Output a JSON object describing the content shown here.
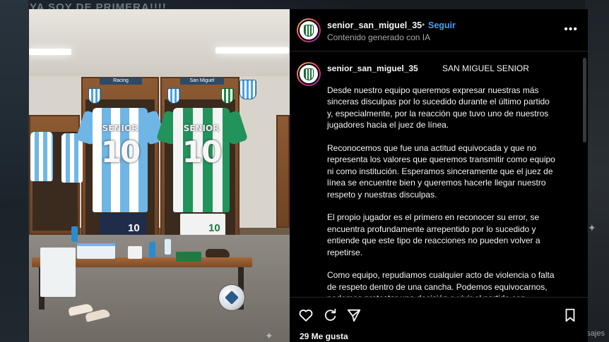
{
  "background": {
    "banner_text": "YA SOY DE PRIMERA!!!!",
    "corner_label": "sajes"
  },
  "image": {
    "left_nameplate": "Racing",
    "right_nameplate": "San Miguel",
    "left_jersey": {
      "name": "SENIOR",
      "number": "10",
      "color": "#6fb6e6"
    },
    "right_jersey": {
      "name": "SENIOR",
      "number": "10",
      "color": "#22935a"
    },
    "left_shorts_number": "10",
    "right_shorts_number": "10"
  },
  "header": {
    "username": "senior_san_miguel_35",
    "separator": "•",
    "follow_label": "Seguir",
    "subtitle": "Contenido generado con IA",
    "more_icon": "more-horizontal-icon"
  },
  "caption": {
    "username": "senior_san_miguel_35",
    "title": "SAN MIGUEL SENIOR",
    "paragraphs": [
      "Desde nuestro equipo queremos expresar nuestras más sinceras disculpas por lo sucedido durante el último partido y, especialmente, por la reacción que tuvo uno de nuestros jugadores hacia el juez de línea.",
      "Reconocemos que fue una actitud equivocada y que no representa los valores que queremos transmitir como equipo ni como institución. Esperamos sinceramente que el juez de línea se encuentre bien y queremos hacerle llegar nuestro respeto y nuestras disculpas.",
      "El propio jugador es el primero en reconocer su error, se encuentra profundamente arrepentido por lo sucedido y entiende que este tipo de reacciones no pueden volver a repetirse.",
      "Como equipo, repudiamos cualquier acto de violencia o falta de respeto dentro de una cancha. Podemos equivocarnos, podemos protestar una decisión o vivir el partido con intensidad, pero siempre debemos mantener el respeto hacia quienes forman"
    ]
  },
  "actions": {
    "like_icon": "heart-icon",
    "comment_icon": "comment-icon",
    "share_icon": "send-icon",
    "save_icon": "bookmark-icon",
    "likes_text": "29 Me gusta"
  },
  "colors": {
    "accent_link": "#4a9eff",
    "panel_bg": "#000000"
  }
}
